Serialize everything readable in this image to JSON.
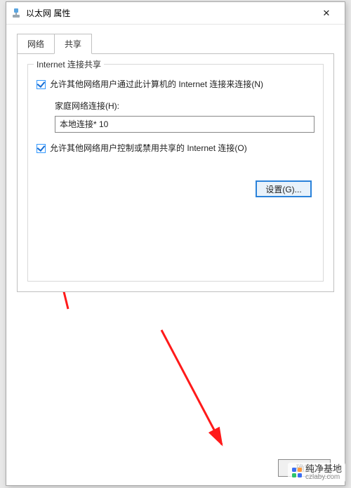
{
  "window": {
    "title": "以太网 属性",
    "close_glyph": "✕"
  },
  "tabs": {
    "network": "网络",
    "sharing": "共享"
  },
  "group": {
    "title": "Internet 连接共享",
    "allow_connect_label": "允许其他网络用户通过此计算机的 Internet 连接来连接(N)",
    "home_network_label": "家庭网络连接(H):",
    "home_network_value": "本地连接* 10",
    "allow_control_label": "允许其他网络用户控制或禁用共享的 Internet 连接(O)",
    "settings_button": "设置(G)..."
  },
  "footer": {
    "ok": "确定"
  },
  "watermark": {
    "name": "纯净基地",
    "url": "czlaby.com"
  },
  "annotation_color": "#ff1a1a"
}
